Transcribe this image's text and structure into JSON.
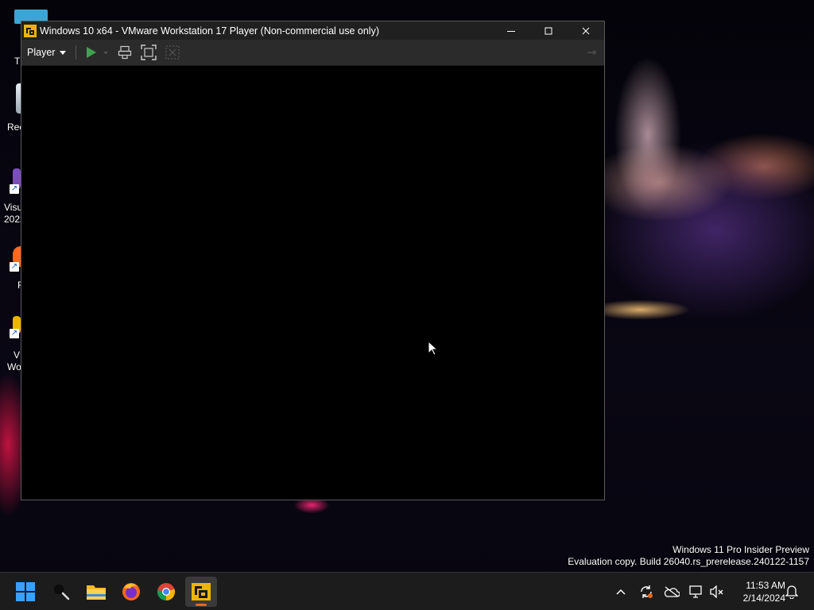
{
  "window": {
    "title": "Windows 10 x64 - VMware Workstation 17 Player (Non-commercial use only)",
    "controls": {
      "minimize": "—",
      "maximize": "□",
      "close": "✕"
    }
  },
  "toolbar": {
    "player_menu": "Player",
    "buttons": [
      {
        "name": "power-on-icon",
        "state": "enabled",
        "color": "#3fa34d"
      },
      {
        "name": "send-ctrl-alt-del-icon"
      },
      {
        "name": "full-screen-icon"
      },
      {
        "name": "unity-icon",
        "state": "disabled"
      }
    ]
  },
  "desktop_icons": [
    {
      "label": "Rec",
      "icon": "recycle-bin-icon"
    },
    {
      "label": "Visu 2022",
      "line1": "Visu",
      "line2": "2022",
      "icon": "visual-studio-icon",
      "color": "#7c4dbd"
    },
    {
      "label": "F",
      "icon": "firefox-icon",
      "color": "#ff6a1a"
    },
    {
      "label": "VI Wo",
      "line1": "VI",
      "line2": "Wo",
      "icon": "vmware-icon",
      "color": "#f0b400"
    },
    {
      "label": "T",
      "icon": "folder-icon",
      "color": "#3aa6d8"
    }
  ],
  "watermark": {
    "line1": "Windows 11 Pro Insider Preview",
    "line2": "Evaluation copy. Build 26040.rs_prerelease.240122-1157"
  },
  "taskbar": {
    "apps": [
      {
        "name": "start-icon"
      },
      {
        "name": "search-icon"
      },
      {
        "name": "file-explorer-icon"
      },
      {
        "name": "firefox-icon"
      },
      {
        "name": "chrome-icon"
      },
      {
        "name": "vmware-player-icon",
        "active": true
      }
    ],
    "tray": [
      {
        "name": "chevron-up-icon"
      },
      {
        "name": "sync-icon"
      },
      {
        "name": "onedrive-icon"
      },
      {
        "name": "display-icon"
      },
      {
        "name": "volume-muted-icon"
      },
      {
        "name": "notifications-icon"
      }
    ],
    "time": "11:53 AM",
    "date": "2/14/2024"
  }
}
